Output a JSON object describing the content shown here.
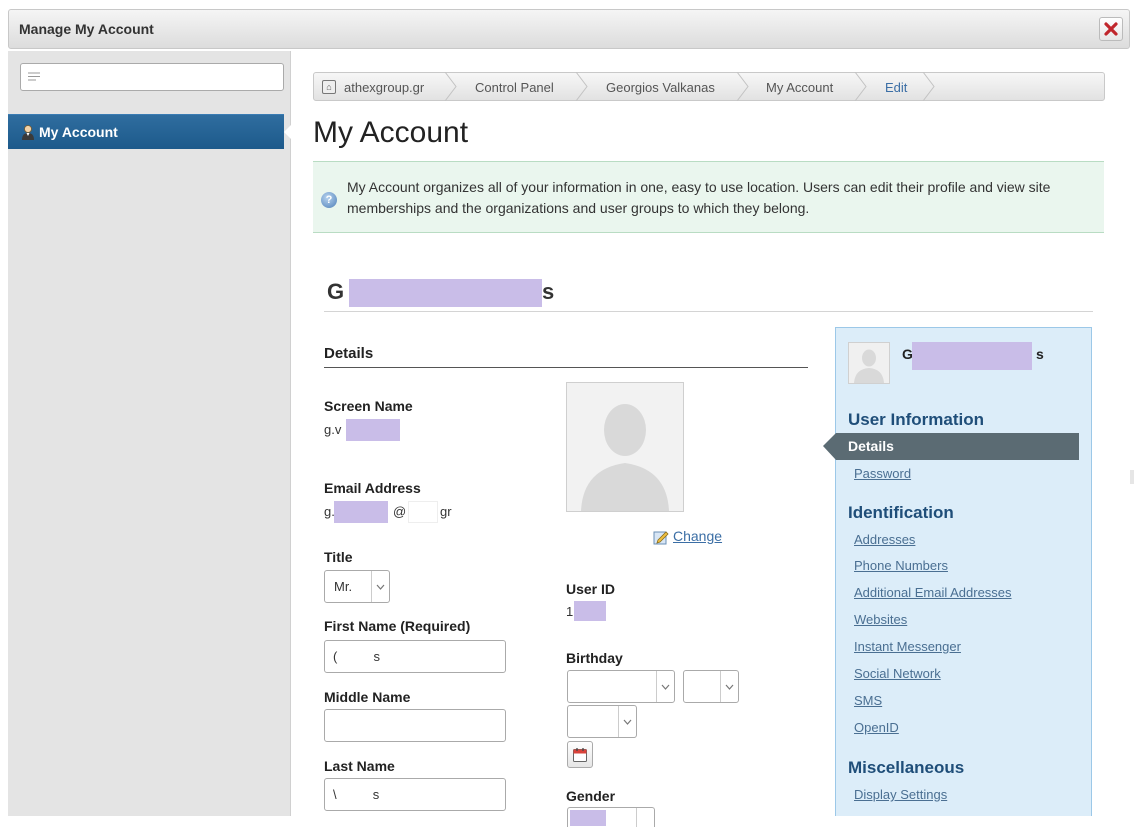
{
  "window": {
    "title": "Manage My Account",
    "close_label": "×"
  },
  "sidebar": {
    "search": {
      "value": "",
      "placeholder": ""
    },
    "items": [
      {
        "label": "My Account",
        "icon": "user-icon",
        "active": true
      }
    ]
  },
  "breadcrumb": [
    "athexgroup.gr",
    "Control Panel",
    "Georgios Valkanas",
    "My Account",
    "Edit"
  ],
  "page": {
    "title": "My Account",
    "info": "My Account organizes all of your information in one, easy to use location. Users can edit their profile and view site memberships and the organizations and user groups to which they belong.",
    "user_name_start": "G",
    "user_name_end": "s"
  },
  "details": {
    "heading": "Details",
    "screen_name": {
      "label": "Screen Name",
      "value": "g.v"
    },
    "email": {
      "label": "Email Address",
      "part1": "g.",
      "at": "@",
      "part2": "gr"
    },
    "title_field": {
      "label": "Title",
      "value": "Mr."
    },
    "first_name": {
      "label": "First Name (Required)",
      "value": "(          s"
    },
    "middle_name": {
      "label": "Middle Name",
      "value": ""
    },
    "last_name": {
      "label": "Last Name",
      "value": "\\          s"
    },
    "change_label": "Change",
    "user_id": {
      "label": "User ID",
      "value": "1"
    },
    "birthday": {
      "label": "Birthday"
    },
    "gender": {
      "label": "Gender"
    }
  },
  "right_panel": {
    "name_start": "G",
    "name_end": "s",
    "sections": [
      {
        "heading": "User Information",
        "items": [
          "Details",
          "Password"
        ]
      },
      {
        "heading": "Identification",
        "items": [
          "Addresses",
          "Phone Numbers",
          "Additional Email Addresses",
          "Websites",
          "Instant Messenger",
          "Social Network",
          "SMS",
          "OpenID"
        ]
      },
      {
        "heading": "Miscellaneous",
        "items": [
          "Display Settings"
        ]
      }
    ]
  },
  "colors": {
    "nav_active": "#1d5a8b",
    "info_bg": "#eaf6ee",
    "panel_bg": "#dcedf9",
    "panel_active": "#5b6b73",
    "redaction": "#c9bde8",
    "link": "#4a6f92"
  }
}
